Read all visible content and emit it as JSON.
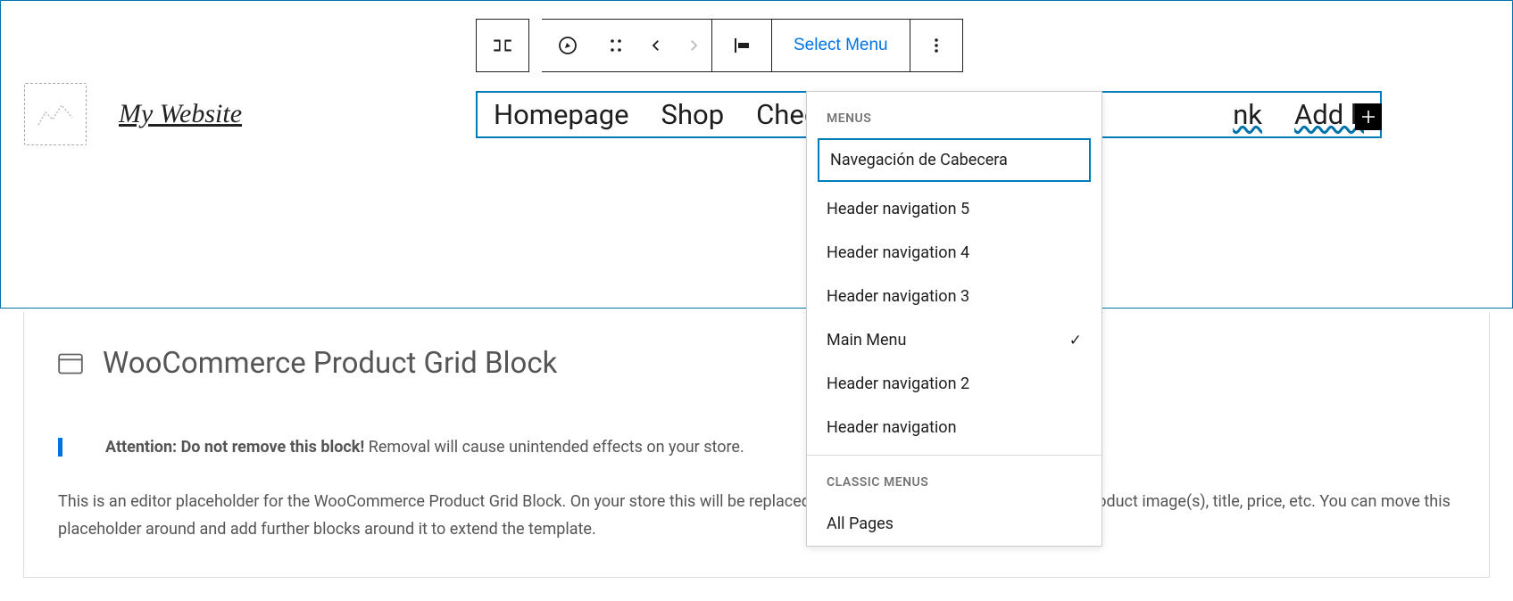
{
  "site_title": "My Website",
  "toolbar": {
    "select_menu_label": "Select Menu"
  },
  "nav": {
    "items": [
      "Homepage",
      "Shop",
      "Chec",
      "nk",
      "Add li"
    ]
  },
  "dropdown": {
    "heading_menus": "MENUS",
    "heading_classic": "CLASSIC MENUS",
    "menus": [
      {
        "label": "Navegación de Cabecera",
        "highlighted": true
      },
      {
        "label": "Header navigation 5"
      },
      {
        "label": "Header navigation 4"
      },
      {
        "label": "Header navigation 3"
      },
      {
        "label": "Main Menu",
        "checked": true
      },
      {
        "label": "Header navigation 2"
      },
      {
        "label": "Header navigation"
      }
    ],
    "classic": [
      {
        "label": "All Pages"
      }
    ]
  },
  "block": {
    "title": "WooCommerce Product Grid Block",
    "attention_strong": "Attention: Do not remove this block!",
    "attention_rest": " Removal will cause unintended effects on your store.",
    "placeholder": "This is an editor placeholder for the WooCommerce Product Grid Block. On your store this will be replaced by the template and display with your product image(s), title, price, etc. You can move this placeholder around and add further blocks around it to extend the template."
  }
}
